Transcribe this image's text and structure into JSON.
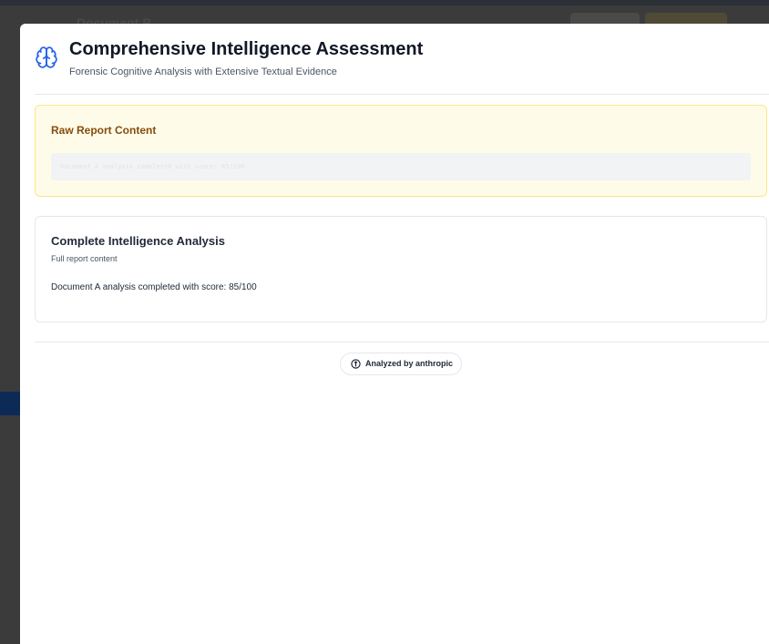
{
  "background": {
    "document_title": "Document B"
  },
  "modal": {
    "header": {
      "icon": "brain-icon",
      "title": "Comprehensive Intelligence Assessment",
      "subtitle": "Forensic Cognitive Analysis with Extensive Textual Evidence"
    },
    "raw_report": {
      "title": "Raw Report Content",
      "content": "Document A analysis completed with score: 85/100"
    },
    "analysis": {
      "title": "Complete Intelligence Analysis",
      "subtitle": "Full report content",
      "body": "Document A analysis completed with score: 85/100"
    },
    "footer": {
      "icon": "info-icon",
      "badge_label": "Analyzed by anthropic"
    }
  },
  "colors": {
    "accent_blue": "#2563eb",
    "raw_bg": "#fefce8",
    "raw_title": "#854d0e"
  }
}
